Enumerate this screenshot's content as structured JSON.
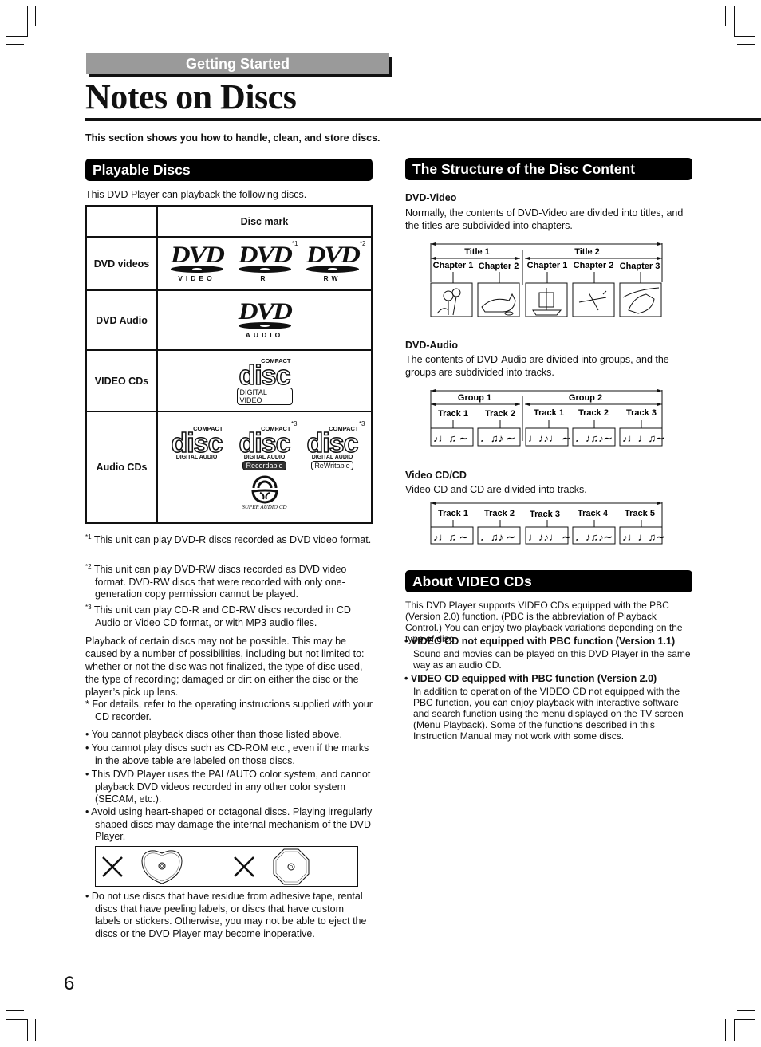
{
  "header": {
    "section_tab": "Getting Started",
    "title": "Notes on Discs",
    "intro": "This section shows you how to handle, clean, and store discs."
  },
  "playable": {
    "heading": "Playable Discs",
    "lead": "This DVD Player can playback the following discs.",
    "table": {
      "column_header": "Disc mark",
      "rows": [
        {
          "label": "DVD videos",
          "marks": [
            {
              "brand": "DVD",
              "sub": "VIDEO",
              "note": ""
            },
            {
              "brand": "DVD",
              "sub": "R",
              "note": "*1"
            },
            {
              "brand": "DVD",
              "sub": "RW",
              "note": "*2"
            }
          ]
        },
        {
          "label": "DVD Audio",
          "marks": [
            {
              "brand": "DVD",
              "sub": "AUDIO",
              "note": ""
            }
          ]
        },
        {
          "label": "VIDEO CDs",
          "marks": [
            {
              "top": "COMPACT",
              "brand": "disc",
              "sub": "DIGITAL VIDEO",
              "note": ""
            }
          ]
        },
        {
          "label": "Audio CDs",
          "marks": [
            {
              "top": "COMPACT",
              "brand": "disc",
              "sub": "DIGITAL AUDIO",
              "pill": "",
              "note": ""
            },
            {
              "top": "COMPACT",
              "brand": "disc",
              "sub": "DIGITAL AUDIO",
              "pill": "Recordable",
              "note": "*3"
            },
            {
              "top": "COMPACT",
              "brand": "disc",
              "sub": "DIGITAL AUDIO",
              "pill": "ReWritable",
              "note": "*3"
            },
            {
              "brand": "SACD",
              "sub": "SUPER AUDIO CD",
              "note": ""
            }
          ]
        }
      ]
    },
    "footnotes": [
      {
        "mark": "*1",
        "text": "This unit can play DVD-R discs recorded as DVD video format."
      },
      {
        "mark": "*2",
        "text": "This unit can play DVD-RW discs recorded as DVD video format. DVD-RW discs that were recorded with only one-generation copy permission cannot be played."
      },
      {
        "mark": "*3",
        "text": "This unit can play CD-R and CD-RW discs recorded in CD Audio or Video CD format, or with MP3 audio files."
      }
    ],
    "playback_note": "Playback of certain discs may not be possible. This may be caused by a number of possibilities, including but not limited to: whether or not the disc was not finalized, the type of disc used, the type of recording; damaged or dirt on either the disc or the player’s pick up lens.",
    "asterisk_note": "For details, refer to the operating instructions supplied with your CD recorder.",
    "bullets": [
      "You cannot playback discs other than those listed above.",
      "You cannot play discs such as CD-ROM etc., even if the marks in the above table are labeled on those discs.",
      "This DVD Player uses the PAL/AUTO color system, and cannot playback DVD videos recorded in any other color system (SECAM, etc.).",
      "Avoid using heart-shaped or octagonal discs. Playing irregularly shaped discs may damage the internal mechanism of the DVD Player.",
      "Do not use discs that have residue from adhesive tape, rental discs that have peeling labels, or discs that have custom labels or stickers. Otherwise, you may not be able to eject the discs or the DVD Player may become inoperative."
    ],
    "shape_examples": [
      {
        "icon": "cross-icon",
        "shape": "heart-shaped-disc"
      },
      {
        "icon": "cross-icon",
        "shape": "octagonal-disc"
      }
    ]
  },
  "structure": {
    "heading": "The Structure of the Disc Content",
    "dvd_video": {
      "title": "DVD-Video",
      "text": "Normally, the contents of DVD-Video are divided into titles, and the titles are subdivided into chapters.",
      "groups": [
        {
          "label": "Title 1",
          "items": [
            "Chapter 1",
            "Chapter 2"
          ]
        },
        {
          "label": "Title 2",
          "items": [
            "Chapter 1",
            "Chapter 2",
            "Chapter 3"
          ]
        }
      ],
      "images": [
        "flowers",
        "cat",
        "ship",
        "airplane",
        "car"
      ]
    },
    "dvd_audio": {
      "title": "DVD-Audio",
      "text": "The contents of DVD-Audio are divided into groups, and the groups are subdivided into tracks.",
      "groups": [
        {
          "label": "Group 1",
          "items": [
            "Track 1",
            "Track 2"
          ]
        },
        {
          "label": "Group 2",
          "items": [
            "Track 1",
            "Track 2",
            "Track 3"
          ]
        }
      ],
      "notes": [
        "♪♩♫ ∼",
        "♩♫♪ ∼",
        "♩♪♪♩ ∼",
        "♩♪♫♪∼",
        "♪♩♩♫∼"
      ]
    },
    "video_cd": {
      "title": "Video CD/CD",
      "text": "Video CD and CD are divided into tracks.",
      "items": [
        "Track 1",
        "Track 2",
        "Track 3",
        "Track 4",
        "Track 5"
      ],
      "notes": [
        "♪♩♫ ∼",
        "♩♫♪ ∼",
        "♩♪♪♩ ∼",
        "♩♪♫♪∼",
        "♪♩♩♫∼"
      ]
    }
  },
  "video_cds": {
    "heading": "About VIDEO CDs",
    "intro": "This DVD Player supports VIDEO CDs equipped with the PBC (Version 2.0) function. (PBC is the abbreviation of Playback Control.) You can enjoy two playback variations depending on the type of disc.",
    "items": [
      {
        "head": "VIDEO CD not equipped with PBC function  (Version 1.1)",
        "body": "Sound and movies can be played on this DVD Player in the same way as an audio CD."
      },
      {
        "head": "VIDEO CD equipped with PBC function  (Version 2.0)",
        "body": "In addition to operation of the VIDEO CD not equipped with the PBC function, you can enjoy playback with interactive software and search function using the menu displayed on the TV screen (Menu Playback). Some of the functions described in this Instruction Manual may not work with some discs."
      }
    ]
  },
  "page_number": "6"
}
